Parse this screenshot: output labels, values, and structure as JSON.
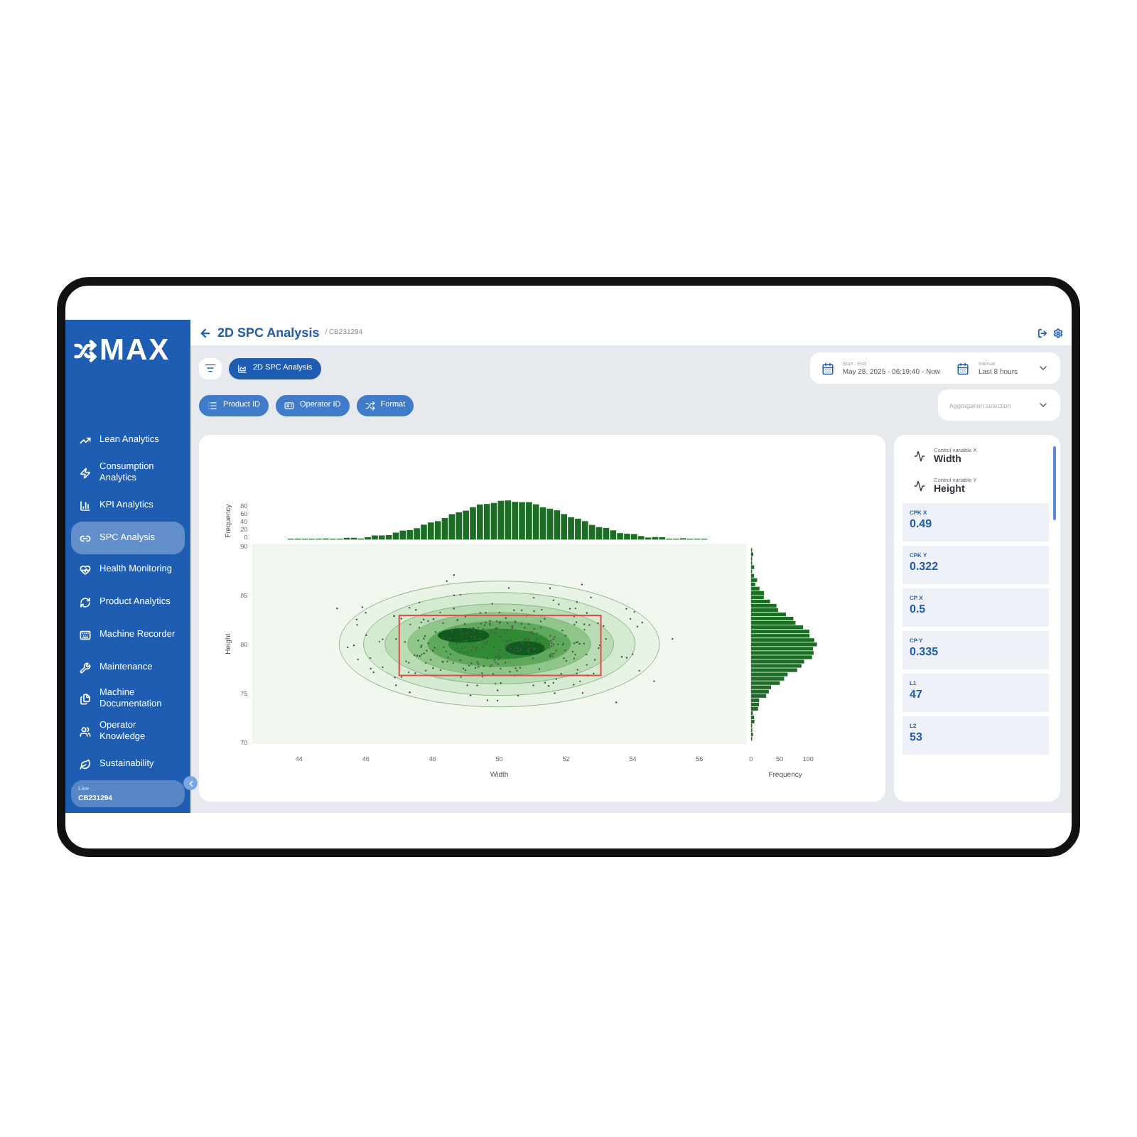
{
  "brand": {
    "name": "MAX"
  },
  "sidebar": {
    "items": [
      {
        "label": "Lean Analytics",
        "selected": false
      },
      {
        "label": "Consumption Analytics",
        "selected": false
      },
      {
        "label": "KPI Analytics",
        "selected": false
      },
      {
        "label": "SPC Analysis",
        "selected": true
      },
      {
        "label": "Health Monitoring",
        "selected": false
      },
      {
        "label": "Product Analytics",
        "selected": false
      },
      {
        "label": "Machine Recorder",
        "selected": false
      },
      {
        "label": "Maintenance",
        "selected": false
      },
      {
        "label": "Machine Documentation",
        "selected": false
      },
      {
        "label": "Operator Knowledge",
        "selected": false
      },
      {
        "label": "Sustainability",
        "selected": false
      }
    ],
    "line": {
      "label": "Line",
      "value": "CB231294"
    }
  },
  "header": {
    "title": "2D SPC Analysis",
    "breadcrumb": "/ CB231294"
  },
  "view_tabs": [
    {
      "label": "2D SPC Analysis",
      "selected": true
    }
  ],
  "filters": [
    {
      "label": "Product ID"
    },
    {
      "label": "Operator ID"
    },
    {
      "label": "Format"
    }
  ],
  "date_range": {
    "label": "Start - End",
    "value": "May 28, 2025 - 06:19:40 - Now"
  },
  "interval": {
    "label": "Interval",
    "value": "Last 8 hours"
  },
  "aggregation": {
    "placeholder": "Aggregation selection"
  },
  "plot": {
    "x_label": "Width",
    "y_label": "Height",
    "top_label": "Frequency",
    "right_label": "Frequency",
    "x_ticks": [
      "44",
      "46",
      "48",
      "50",
      "52",
      "54",
      "56"
    ],
    "y_ticks": [
      "90",
      "85",
      "80",
      "75",
      "70"
    ],
    "top_ticks": [
      "80",
      "60",
      "40",
      "20",
      "0"
    ],
    "right_ticks": [
      "0",
      "50",
      "100"
    ]
  },
  "variables": [
    {
      "label": "Control variable X",
      "value": "Width"
    },
    {
      "label": "Control variable Y",
      "value": "Height"
    }
  ],
  "metrics": [
    {
      "label": "CPK X",
      "value": "0.49"
    },
    {
      "label": "CPK Y",
      "value": "0.322"
    },
    {
      "label": "CP X",
      "value": "0.5"
    },
    {
      "label": "CP Y",
      "value": "0.335"
    },
    {
      "label": "L1",
      "value": "47"
    },
    {
      "label": "L2",
      "value": "53"
    }
  ]
}
